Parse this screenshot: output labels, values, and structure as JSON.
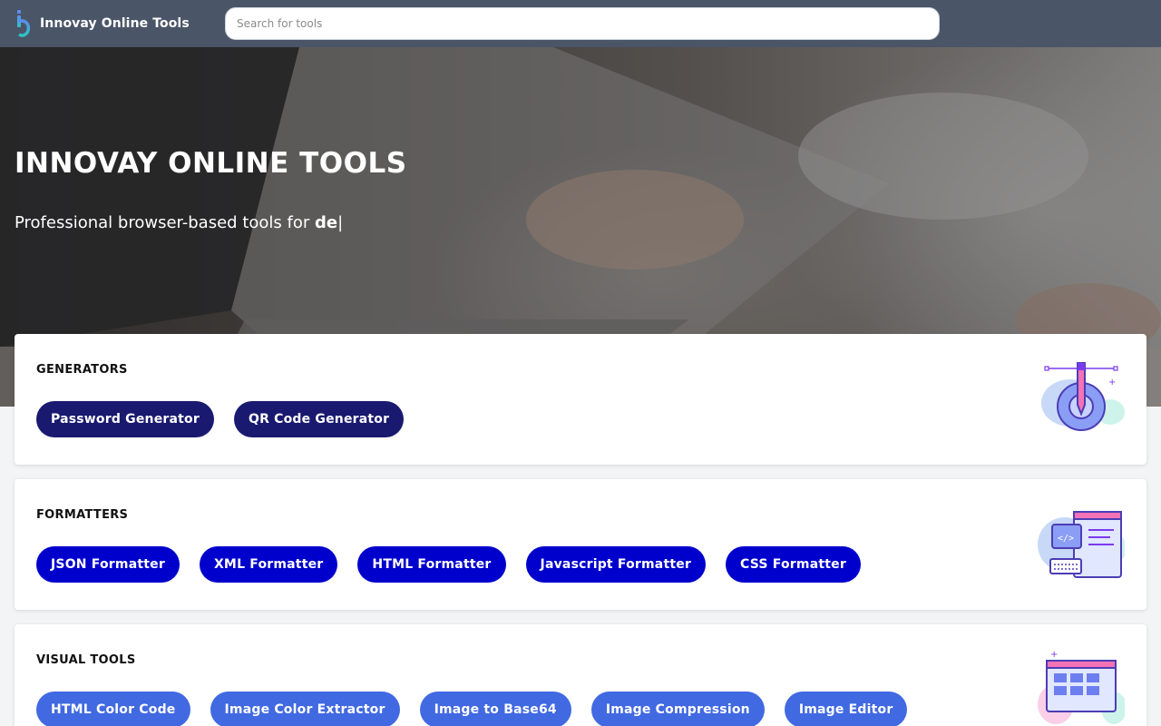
{
  "header": {
    "brand_name": "Innovay Online Tools",
    "search_placeholder": "Search for tools"
  },
  "hero": {
    "title": "INNOVAY ONLINE TOOLS",
    "subtitle_prefix": "Professional browser-based tools for ",
    "subtitle_typed": "de",
    "cursor": "|"
  },
  "categories": [
    {
      "title": "GENERATORS",
      "button_color": "#191970",
      "tools": [
        "Password Generator",
        "QR Code Generator"
      ],
      "icon": "settings-gear-pencil-illustration"
    },
    {
      "title": "FORMATTERS",
      "button_color": "#0000cd",
      "tools": [
        "JSON Formatter",
        "XML Formatter",
        "HTML Formatter",
        "Javascript Formatter",
        "CSS Formatter"
      ],
      "icon": "code-window-keyboard-illustration"
    },
    {
      "title": "VISUAL TOOLS",
      "button_color": "#4169e1",
      "tools": [
        "HTML Color Code",
        "Image Color Extractor",
        "Image to Base64",
        "Image Compression",
        "Image Editor"
      ],
      "icon": "monitor-grid-illustration"
    }
  ],
  "colors": {
    "header_bg": "#4a5568",
    "accent_purple": "#7c3aed",
    "accent_pink": "#f472b6"
  }
}
